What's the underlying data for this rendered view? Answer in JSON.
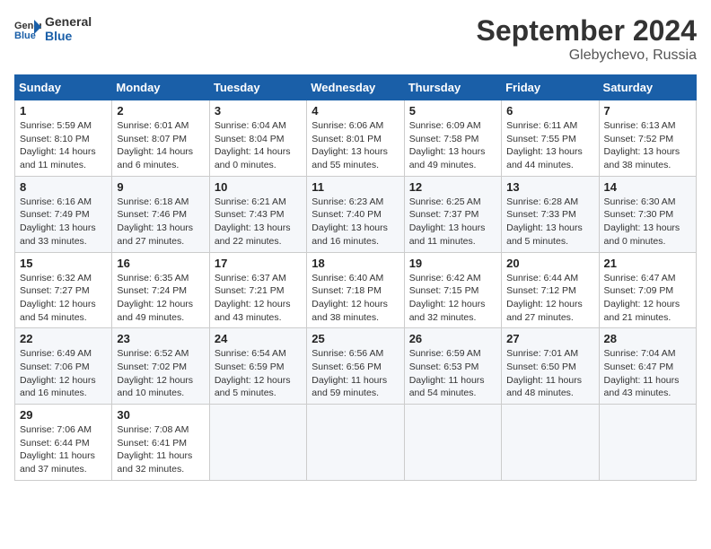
{
  "header": {
    "logo_line1": "General",
    "logo_line2": "Blue",
    "month_title": "September 2024",
    "location": "Glebychevo, Russia"
  },
  "weekdays": [
    "Sunday",
    "Monday",
    "Tuesday",
    "Wednesday",
    "Thursday",
    "Friday",
    "Saturday"
  ],
  "weeks": [
    [
      {
        "day": "1",
        "info": "Sunrise: 5:59 AM\nSunset: 8:10 PM\nDaylight: 14 hours\nand 11 minutes."
      },
      {
        "day": "2",
        "info": "Sunrise: 6:01 AM\nSunset: 8:07 PM\nDaylight: 14 hours\nand 6 minutes."
      },
      {
        "day": "3",
        "info": "Sunrise: 6:04 AM\nSunset: 8:04 PM\nDaylight: 14 hours\nand 0 minutes."
      },
      {
        "day": "4",
        "info": "Sunrise: 6:06 AM\nSunset: 8:01 PM\nDaylight: 13 hours\nand 55 minutes."
      },
      {
        "day": "5",
        "info": "Sunrise: 6:09 AM\nSunset: 7:58 PM\nDaylight: 13 hours\nand 49 minutes."
      },
      {
        "day": "6",
        "info": "Sunrise: 6:11 AM\nSunset: 7:55 PM\nDaylight: 13 hours\nand 44 minutes."
      },
      {
        "day": "7",
        "info": "Sunrise: 6:13 AM\nSunset: 7:52 PM\nDaylight: 13 hours\nand 38 minutes."
      }
    ],
    [
      {
        "day": "8",
        "info": "Sunrise: 6:16 AM\nSunset: 7:49 PM\nDaylight: 13 hours\nand 33 minutes."
      },
      {
        "day": "9",
        "info": "Sunrise: 6:18 AM\nSunset: 7:46 PM\nDaylight: 13 hours\nand 27 minutes."
      },
      {
        "day": "10",
        "info": "Sunrise: 6:21 AM\nSunset: 7:43 PM\nDaylight: 13 hours\nand 22 minutes."
      },
      {
        "day": "11",
        "info": "Sunrise: 6:23 AM\nSunset: 7:40 PM\nDaylight: 13 hours\nand 16 minutes."
      },
      {
        "day": "12",
        "info": "Sunrise: 6:25 AM\nSunset: 7:37 PM\nDaylight: 13 hours\nand 11 minutes."
      },
      {
        "day": "13",
        "info": "Sunrise: 6:28 AM\nSunset: 7:33 PM\nDaylight: 13 hours\nand 5 minutes."
      },
      {
        "day": "14",
        "info": "Sunrise: 6:30 AM\nSunset: 7:30 PM\nDaylight: 13 hours\nand 0 minutes."
      }
    ],
    [
      {
        "day": "15",
        "info": "Sunrise: 6:32 AM\nSunset: 7:27 PM\nDaylight: 12 hours\nand 54 minutes."
      },
      {
        "day": "16",
        "info": "Sunrise: 6:35 AM\nSunset: 7:24 PM\nDaylight: 12 hours\nand 49 minutes."
      },
      {
        "day": "17",
        "info": "Sunrise: 6:37 AM\nSunset: 7:21 PM\nDaylight: 12 hours\nand 43 minutes."
      },
      {
        "day": "18",
        "info": "Sunrise: 6:40 AM\nSunset: 7:18 PM\nDaylight: 12 hours\nand 38 minutes."
      },
      {
        "day": "19",
        "info": "Sunrise: 6:42 AM\nSunset: 7:15 PM\nDaylight: 12 hours\nand 32 minutes."
      },
      {
        "day": "20",
        "info": "Sunrise: 6:44 AM\nSunset: 7:12 PM\nDaylight: 12 hours\nand 27 minutes."
      },
      {
        "day": "21",
        "info": "Sunrise: 6:47 AM\nSunset: 7:09 PM\nDaylight: 12 hours\nand 21 minutes."
      }
    ],
    [
      {
        "day": "22",
        "info": "Sunrise: 6:49 AM\nSunset: 7:06 PM\nDaylight: 12 hours\nand 16 minutes."
      },
      {
        "day": "23",
        "info": "Sunrise: 6:52 AM\nSunset: 7:02 PM\nDaylight: 12 hours\nand 10 minutes."
      },
      {
        "day": "24",
        "info": "Sunrise: 6:54 AM\nSunset: 6:59 PM\nDaylight: 12 hours\nand 5 minutes."
      },
      {
        "day": "25",
        "info": "Sunrise: 6:56 AM\nSunset: 6:56 PM\nDaylight: 11 hours\nand 59 minutes."
      },
      {
        "day": "26",
        "info": "Sunrise: 6:59 AM\nSunset: 6:53 PM\nDaylight: 11 hours\nand 54 minutes."
      },
      {
        "day": "27",
        "info": "Sunrise: 7:01 AM\nSunset: 6:50 PM\nDaylight: 11 hours\nand 48 minutes."
      },
      {
        "day": "28",
        "info": "Sunrise: 7:04 AM\nSunset: 6:47 PM\nDaylight: 11 hours\nand 43 minutes."
      }
    ],
    [
      {
        "day": "29",
        "info": "Sunrise: 7:06 AM\nSunset: 6:44 PM\nDaylight: 11 hours\nand 37 minutes."
      },
      {
        "day": "30",
        "info": "Sunrise: 7:08 AM\nSunset: 6:41 PM\nDaylight: 11 hours\nand 32 minutes."
      },
      {
        "day": "",
        "info": ""
      },
      {
        "day": "",
        "info": ""
      },
      {
        "day": "",
        "info": ""
      },
      {
        "day": "",
        "info": ""
      },
      {
        "day": "",
        "info": ""
      }
    ]
  ]
}
